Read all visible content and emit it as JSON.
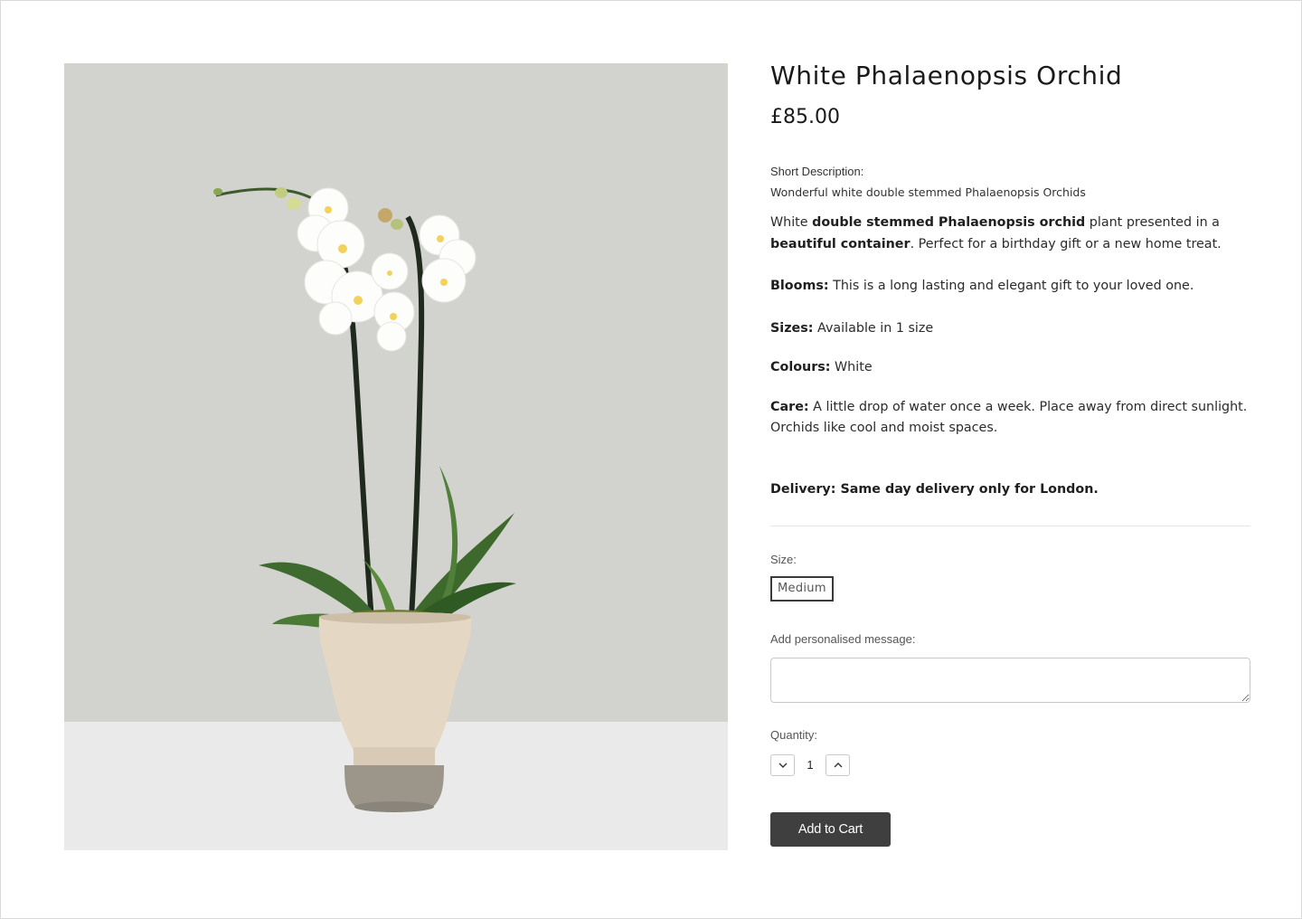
{
  "product": {
    "title": "White Phalaenopsis Orchid",
    "price": "£85.00",
    "short_description_label": "Short Description:",
    "short_description": "Wonderful white double stemmed Phalaenopsis Orchids",
    "description": {
      "intro_1": "White ",
      "intro_bold_1": "double stemmed Phalaenopsis orchid",
      "intro_2": " plant presented in a ",
      "intro_bold_2": "beautiful container",
      "intro_3": ". Perfect for a birthday gift or a new home treat.",
      "blooms_label": "Blooms:",
      "blooms_text": " This is a long lasting and elegant gift to your loved one.",
      "sizes_label": "Sizes:",
      "sizes_text": " Available in 1 size",
      "colours_label": "Colours:",
      "colours_text": " White",
      "care_label": "Care:",
      "care_text": " A little drop of water once a week. Place away from direct sunlight. Orchids like cool and moist spaces."
    },
    "delivery": "Delivery: Same day delivery only for London."
  },
  "options": {
    "size_label": "Size:",
    "size_selected": "Medium",
    "message_label": "Add personalised message:",
    "message_value": "",
    "quantity_label": "Quantity:",
    "quantity_value": "1",
    "add_to_cart_label": "Add to Cart"
  },
  "icons": {
    "decrement": "chevron-down-icon",
    "increment": "chevron-up-icon"
  },
  "colors": {
    "button_bg": "#3f3f3f",
    "image_background": "#d2d2cf",
    "image_table": "#e9eae9"
  }
}
